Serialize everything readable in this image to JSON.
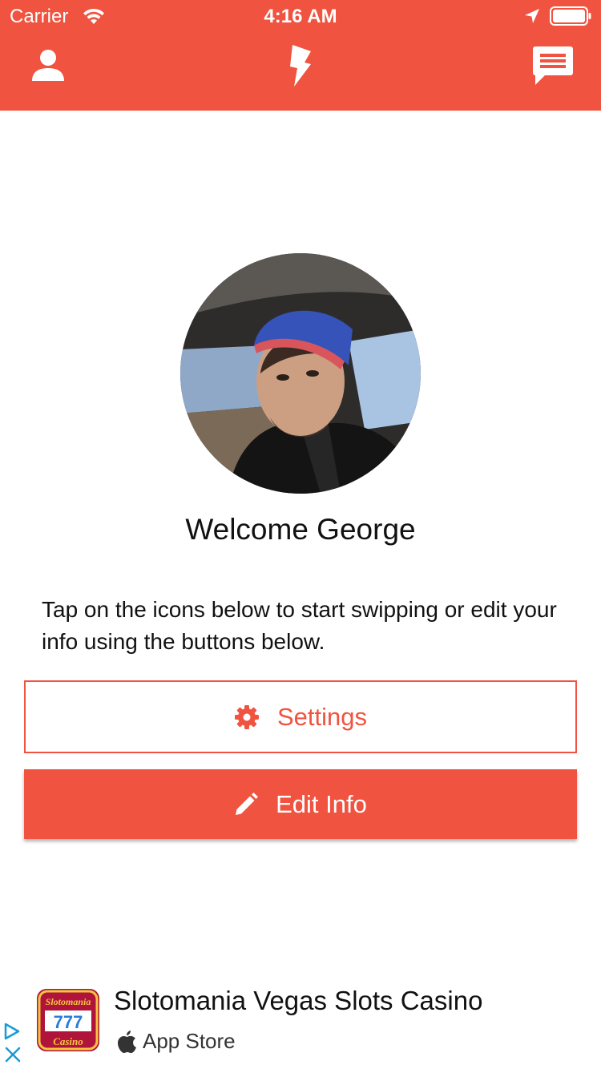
{
  "status_bar": {
    "carrier": "Carrier",
    "time": "4:16 AM",
    "icons": [
      "wifi-icon",
      "location-arrow-icon",
      "battery-icon"
    ]
  },
  "nav": {
    "items": [
      "profile-icon",
      "lightning-icon",
      "chat-icon"
    ]
  },
  "profile": {
    "welcome_text": "Welcome George",
    "instructions": "Tap on the icons below to start swipping or edit your info using the buttons below."
  },
  "buttons": {
    "settings_label": "Settings",
    "settings_icon": "gear-icon",
    "edit_label": "Edit Info",
    "edit_icon": "pencil-icon"
  },
  "ad": {
    "title": "Slotomania Vegas Slots Casino",
    "store": "App Store",
    "app_icon_text_top": "Slotomania",
    "app_icon_text_mid": "777",
    "app_icon_text_bottom": "Casino"
  },
  "colors": {
    "accent": "#f0533f",
    "white": "#ffffff",
    "text": "#111111"
  }
}
